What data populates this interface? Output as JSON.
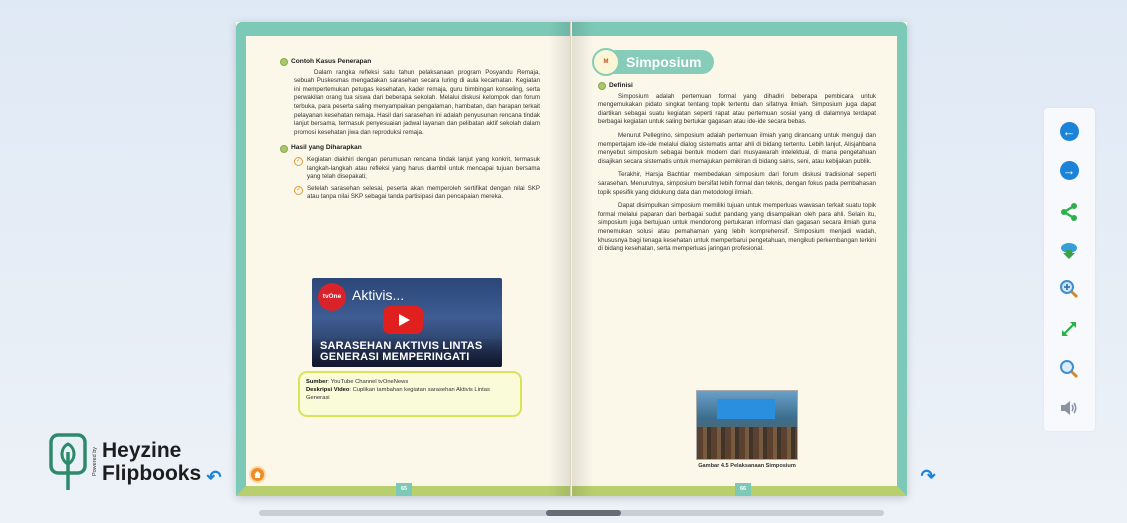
{
  "brand": {
    "powered_by": "Powered by",
    "name_line1": "Heyzine",
    "name_line2": "Flipbooks",
    "color": "#2d8a6a"
  },
  "left_page": {
    "number": "65",
    "section1_title": "Contoh Kasus Penerapan",
    "section1_body": "Dalam rangka refleksi satu tahun pelaksanaan program Posyandu Remaja, sebuah Puskesmas mengadakan sarasehan secara luring di aula kecamatan. Kegiatan ini mempertemukan petugas kesehatan, kader remaja, guru bimbingan konseling, serta perwakilan orang tua siswa dari beberapa sekolah. Melalui diskusi kelompok dan forum terbuka, para peserta saling menyampaikan pengalaman, hambatan, dan harapan terkait pelayanan kesehatan remaja. Hasil dari sarasehan ini adalah penyusunan rencana tindak lanjut bersama, termasuk penyesuaian jadwal layanan dan pelibatan aktif sekolah dalam promosi kesehatan jiwa dan reproduksi remaja.",
    "section2_title": "Hasil yang Diharapkan",
    "results": [
      "Kegiatan diakhiri dengan perumusan rencana tindak lanjut yang konkrit, termasuk langkah-langkah atau refleksi yang harus diambil untuk mencapai tujuan bersama yang telah disepakati;",
      "Setelah sarasehan selesai, peserta akan memperoleh sertifikat dengan nilai SKP atau tanpa nilai SKP sebagai tanda partisipasi dan pencapaian mereka."
    ],
    "video": {
      "channel_logo": "tvOne",
      "title": "Aktivis...",
      "banner_line1": "SARASEHAN AKTIVIS LINTAS",
      "banner_line2": "GENERASI MEMPERINGATI"
    },
    "source_label": "Sumber",
    "source_value": ": YouTube Channel tvOneNews",
    "desc_label": "Deskripsi Video",
    "desc_value": ": Cuplikan tambahan kegiatan sarasehan Aktivis Lintas Generasi"
  },
  "right_page": {
    "number": "66",
    "title": "Simposium",
    "badge_logo": "M",
    "definition_title": "Definisi",
    "paragraphs": [
      "Simposium adalah pertemuan formal yang dihadiri beberapa pembicara untuk mengemukakan pidato singkat tentang topik tertentu dan sifatnya ilmiah. Simposium juga dapat diartikan sebagai suatu kegiatan seperti rapat atau pertemuan sosial yang di dalamnya terdapat berbagai kegiatan untuk saling bertukar gagasan atau ide-ide secara bebas.",
      "Menurut Pellegrino, simposium adalah pertemuan ilmiah yang dirancang untuk menguji dan mempertajam ide-ide melalui dialog sistematis antar ahli di bidang tertentu. Lebih lanjut, Alisjahbana menyebut simposium sebagai bentuk modern dari musyawarah intelektual, di mana pengetahuan disajikan secara sistematis untuk memajukan pemikiran di bidang sains, seni, atau kebijakan publik.",
      "Terakhir, Harsja Bachtiar membedakan simposium dari forum diskusi tradisional seperti sarasehan. Menurutnya, simposium bersifat lebih formal dan teknis, dengan fokus pada pembahasan topik spesifik yang didukung data dan metodologi ilmiah.",
      "Dapat disimpulkan simposium memiliki tujuan untuk memperluas wawasan terkait suatu topik formal melalui paparan dari berbagai sudut pandang yang disampaikan oleh para ahli. Selain itu, simposium juga bertujuan untuk mendorong pertukaran informasi dan gagasan secara ilmiah guna menemukan solusi atau pemahaman yang lebih komprehensif. Simposium menjadi wadah, khususnya bagi tenaga kesehatan untuk memperbarui pengetahuan, mengikuti perkembangan terkini di bidang kesehatan, serta memperluas jaringan profesional."
    ],
    "figure_caption": "Gambar 4.5 Pelaksanaan Simposium"
  },
  "toolbar": {
    "accent": "#1b84d8",
    "items": [
      {
        "name": "previous-page-icon"
      },
      {
        "name": "next-page-icon"
      },
      {
        "name": "share-icon"
      },
      {
        "name": "download-icon"
      },
      {
        "name": "zoom-in-icon"
      },
      {
        "name": "fullscreen-icon"
      },
      {
        "name": "search-icon"
      },
      {
        "name": "sound-icon"
      }
    ]
  },
  "colors": {
    "page_border": "#7cc9b8",
    "page_bottom": "#b9cf6e",
    "source_border": "#d8e35a"
  }
}
